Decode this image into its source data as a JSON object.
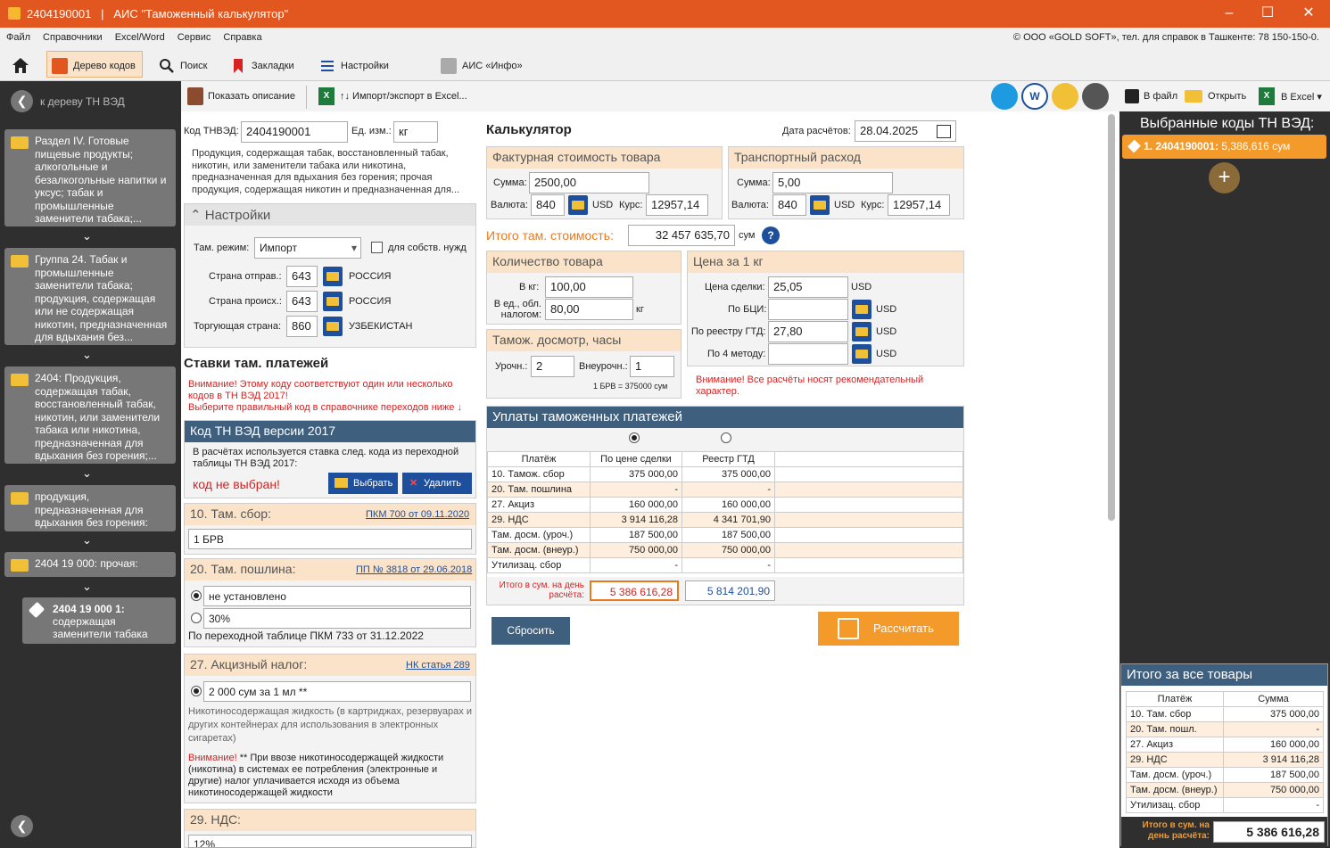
{
  "window": {
    "code": "2404190001",
    "sep": "|",
    "title": "АИС \"Таможенный калькулятор\""
  },
  "menu": [
    "Файл",
    "Справочники",
    "Excel/Word",
    "Сервис",
    "Справка"
  ],
  "copyright": "© ООО «GOLD SOFT», тел. для справок в Ташкенте: 78 150-150-0.",
  "toolbar": {
    "tree": "Дерево кодов",
    "search": "Поиск",
    "bookmarks": "Закладки",
    "settings": "Настройки",
    "info": "АИС «Инфо»"
  },
  "subbar": {
    "show_desc": "Показать описание",
    "import": "↑↓ Импорт/экспорт в Excel..."
  },
  "right_toolbar": {
    "to_file": "В файл",
    "open": "Открыть",
    "to_excel": "В Excel"
  },
  "tree": {
    "back": "к дереву ТН ВЭД",
    "nodes": [
      "Раздел IV. Готовые пищевые продукты; алкогольные и безалкогольные напитки и уксус; табак и промышленные заменители табака;...",
      "Группа 24. Табак и промышленные заменители табака; продукция, содержащая или не содержащая никотин, предназначенная для вдыхания без...",
      "2404: Продукция, содержащая табак, восстановленный табак, никотин, или заменители табака или никотина, предназначенная для вдыхания без горения;...",
      "продукция, предназначенная для вдыхания без горения:",
      "2404 19 000: прочая:"
    ],
    "leaf_code": "2404 19 000 1:",
    "leaf_text": "содержащая заменители табака"
  },
  "code": {
    "label": "Код ТНВЭД:",
    "value": "2404190001",
    "unit_label": "Ед. изм.:",
    "unit": "кг",
    "desc": "Продукция, содержащая табак, восстановленный табак, никотин, или заменители табака или никотина, предназначенная для вдыхания без горения; прочая продукция, содержащая никотин и предназначенная для..."
  },
  "settings": {
    "title": "Настройки",
    "regime_label": "Там. режим:",
    "regime": "Импорт",
    "own_needs": "для собств. нужд",
    "send_label": "Страна отправ.:",
    "send_code": "643",
    "send_name": "РОССИЯ",
    "origin_label": "Страна происх.:",
    "origin_code": "643",
    "origin_name": "РОССИЯ",
    "trade_label": "Торгующая страна:",
    "trade_code": "860",
    "trade_name": "УЗБЕКИСТАН"
  },
  "rates": {
    "title": "Ставки там. платежей",
    "warn1": "Внимание! Этому коду соответствуют один или несколько кодов в ТН ВЭД 2017!",
    "warn2": "Выберите правильный код в справочнике переходов ниже ↓"
  },
  "ved2017": {
    "title": "Код ТН ВЭД версии 2017",
    "text": "В расчётах используется ставка след. кода из переходной таблицы ТН ВЭД 2017:",
    "notsel": "код не выбран!",
    "select": "Выбрать",
    "delete": "Удалить"
  },
  "fee10": {
    "title": "10. Там. сбор:",
    "link": "ПКМ 700 от 09.11.2020",
    "value": "1 БРВ"
  },
  "fee20": {
    "title": "20. Там. пошлина:",
    "link": "ПП № 3818 от 29.06.2018",
    "opt1": "не установлено",
    "opt2": "30%",
    "note": "По переходной таблице ПКМ 733 от 31.12.2022"
  },
  "fee27": {
    "title": "27. Акцизный налог:",
    "link": "НК статья 289",
    "opt1": "2 000 сум за 1 мл **",
    "desc": "Никотиносодержащая жидкость (в картриджах, резервуарах и других контейнерах для использования в электронных сигаретах)",
    "warn_label": "Внимание!",
    "warn": "** При ввозе никотиносодержащей жидкости (никотина) в системах ее потребления (электронные и другие) налог уплачивается исходя из объема никотиносодержащей жидкости"
  },
  "fee29": {
    "title": "29. НДС:",
    "value": "12%"
  },
  "calc": {
    "title": "Калькулятор",
    "date_label": "Дата расчётов:",
    "date": "28.04.2025",
    "invoice_title": "Фактурная стоимость товара",
    "sum_label": "Сумма:",
    "invoice_sum": "2500,00",
    "cur_label": "Валюта:",
    "invoice_cur": "840",
    "usd": "USD",
    "rate_label": "Курс:",
    "invoice_rate": "12957,14",
    "transport_title": "Транспортный расход",
    "transport_sum": "5,00",
    "transport_cur": "840",
    "transport_rate": "12957,14",
    "total_label": "Итого там. стоимость:",
    "total": "32 457 635,70",
    "sum_unit": "сум",
    "qty_title": "Количество товара",
    "kg_label": "В кг:",
    "kg": "100,00",
    "unit_label": "В ед., обл. налогом:",
    "unit_val": "80,00",
    "unit": "кг",
    "price_title": "Цена за 1 кг",
    "deal_label": "Цена сделки:",
    "deal": "25,05",
    "bci_label": "По БЦИ:",
    "gtd_label": "По реестру ГТД:",
    "gtd": "27,80",
    "m4_label": "По 4 методу:",
    "insp_title": "Тамож. досмотр, часы",
    "work_label": "Урочн.:",
    "work": "2",
    "extra_label": "Внеурочн.:",
    "extra": "1",
    "brv": "1 БРВ = 375000 сум",
    "warn": "Внимание! Все расчёты носят рекомендательный характер.",
    "pay_title": "Уплаты таможенных платежей",
    "pay_headers": [
      "Платёж",
      "По цене сделки",
      "Реестр ГТД"
    ],
    "pay_rows": [
      [
        "10. Тамож. сбор",
        "375 000,00",
        "375 000,00"
      ],
      [
        "20. Там. пошлина",
        "-",
        "-"
      ],
      [
        "27. Акциз",
        "160 000,00",
        "160 000,00"
      ],
      [
        "29. НДС",
        "3 914 116,28",
        "4 341 701,90"
      ],
      [
        "Там. досм. (уроч.)",
        "187 500,00",
        "187 500,00"
      ],
      [
        "Там. досм. (внеур.)",
        "750 000,00",
        "750 000,00"
      ],
      [
        "Утилизац. сбор",
        "-",
        "-"
      ]
    ],
    "pay_total_label": "Итого в сум. на день расчёта:",
    "pay_total1": "5 386 616,28",
    "pay_total2": "5 814 201,90",
    "reset": "Сбросить",
    "compute": "Рассчитать"
  },
  "selected": {
    "title": "Выбранные коды ТН ВЭД:",
    "item_code": "1. 2404190001:",
    "item_sum": "5,386,616 сум"
  },
  "summary": {
    "title": "Итого за все товары",
    "headers": [
      "Платёж",
      "Сумма"
    ],
    "rows": [
      [
        "10. Там. сбор",
        "375 000,00"
      ],
      [
        "20. Там. пошл.",
        "-"
      ],
      [
        "27. Акциз",
        "160 000,00"
      ],
      [
        "29. НДС",
        "3 914 116,28"
      ],
      [
        "Там. досм. (уроч.)",
        "187 500,00"
      ],
      [
        "Там. досм. (внеур.)",
        "750 000,00"
      ],
      [
        "Утилизац. сбор",
        "-"
      ]
    ],
    "total_label": "Итого в сум. на день расчёта:",
    "total": "5 386 616,28"
  },
  "colors": {
    "accent": "#e2561f",
    "orange": "#f39a2b",
    "navy": "#3e5f7e"
  }
}
